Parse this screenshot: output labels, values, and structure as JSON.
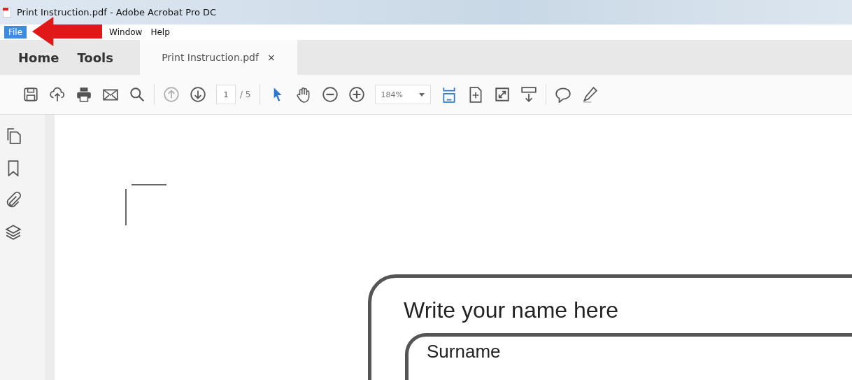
{
  "window": {
    "title": "Print Instruction.pdf - Adobe Acrobat Pro DC"
  },
  "menu": [
    {
      "label": "File",
      "selected": true
    },
    {
      "label": "Window",
      "selected": false
    },
    {
      "label": "Help",
      "selected": false
    }
  ],
  "nav_tabs": [
    {
      "label": "Home"
    },
    {
      "label": "Tools"
    }
  ],
  "document_tab": {
    "label": "Print Instruction.pdf",
    "close": "×"
  },
  "toolbar": {
    "groups": [
      [
        {
          "kind": "save",
          "selected": false,
          "disabled": false
        },
        {
          "kind": "upload",
          "selected": false,
          "disabled": false
        },
        {
          "kind": "print",
          "selected": false,
          "disabled": false
        },
        {
          "kind": "mail",
          "selected": false,
          "disabled": false
        },
        {
          "kind": "search",
          "selected": false,
          "disabled": false
        }
      ],
      [
        {
          "kind": "prev",
          "selected": false,
          "disabled": true
        },
        {
          "kind": "next",
          "selected": false,
          "disabled": false
        },
        {
          "kind": "page",
          "value": "1",
          "total": "/ 5"
        }
      ],
      [
        {
          "kind": "pointer",
          "selected": true,
          "disabled": false
        },
        {
          "kind": "hand",
          "selected": false,
          "disabled": false
        },
        {
          "kind": "zoomout",
          "selected": false,
          "disabled": false
        },
        {
          "kind": "zoomin",
          "selected": false,
          "disabled": false
        },
        {
          "kind": "zoom",
          "value": "184%"
        },
        {
          "kind": "fitpage",
          "selected": true,
          "disabled": false
        },
        {
          "kind": "fitwidth",
          "selected": false,
          "disabled": false
        },
        {
          "kind": "fullscreen",
          "selected": false,
          "disabled": false
        },
        {
          "kind": "scroll",
          "selected": false,
          "disabled": false
        }
      ],
      [
        {
          "kind": "comment",
          "selected": false,
          "disabled": false
        },
        {
          "kind": "pen",
          "selected": false,
          "disabled": false
        }
      ]
    ]
  },
  "sidebar": {
    "items": [
      {
        "kind": "pages"
      },
      {
        "kind": "bookmark"
      },
      {
        "kind": "attachment"
      },
      {
        "kind": "layers"
      }
    ]
  },
  "document": {
    "heading": "Write your name here",
    "field_label": "Surname"
  }
}
